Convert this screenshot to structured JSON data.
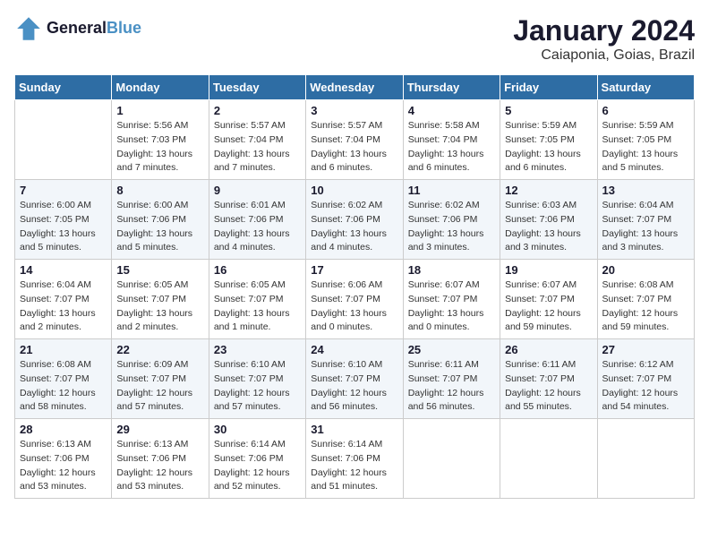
{
  "logo": {
    "line1": "General",
    "line2": "Blue"
  },
  "title": "January 2024",
  "location": "Caiaponia, Goias, Brazil",
  "days_header": [
    "Sunday",
    "Monday",
    "Tuesday",
    "Wednesday",
    "Thursday",
    "Friday",
    "Saturday"
  ],
  "weeks": [
    [
      {
        "day": "",
        "sunrise": "",
        "sunset": "",
        "daylight": ""
      },
      {
        "day": "1",
        "sunrise": "Sunrise: 5:56 AM",
        "sunset": "Sunset: 7:03 PM",
        "daylight": "Daylight: 13 hours and 7 minutes."
      },
      {
        "day": "2",
        "sunrise": "Sunrise: 5:57 AM",
        "sunset": "Sunset: 7:04 PM",
        "daylight": "Daylight: 13 hours and 7 minutes."
      },
      {
        "day": "3",
        "sunrise": "Sunrise: 5:57 AM",
        "sunset": "Sunset: 7:04 PM",
        "daylight": "Daylight: 13 hours and 6 minutes."
      },
      {
        "day": "4",
        "sunrise": "Sunrise: 5:58 AM",
        "sunset": "Sunset: 7:04 PM",
        "daylight": "Daylight: 13 hours and 6 minutes."
      },
      {
        "day": "5",
        "sunrise": "Sunrise: 5:59 AM",
        "sunset": "Sunset: 7:05 PM",
        "daylight": "Daylight: 13 hours and 6 minutes."
      },
      {
        "day": "6",
        "sunrise": "Sunrise: 5:59 AM",
        "sunset": "Sunset: 7:05 PM",
        "daylight": "Daylight: 13 hours and 5 minutes."
      }
    ],
    [
      {
        "day": "7",
        "sunrise": "Sunrise: 6:00 AM",
        "sunset": "Sunset: 7:05 PM",
        "daylight": "Daylight: 13 hours and 5 minutes."
      },
      {
        "day": "8",
        "sunrise": "Sunrise: 6:00 AM",
        "sunset": "Sunset: 7:06 PM",
        "daylight": "Daylight: 13 hours and 5 minutes."
      },
      {
        "day": "9",
        "sunrise": "Sunrise: 6:01 AM",
        "sunset": "Sunset: 7:06 PM",
        "daylight": "Daylight: 13 hours and 4 minutes."
      },
      {
        "day": "10",
        "sunrise": "Sunrise: 6:02 AM",
        "sunset": "Sunset: 7:06 PM",
        "daylight": "Daylight: 13 hours and 4 minutes."
      },
      {
        "day": "11",
        "sunrise": "Sunrise: 6:02 AM",
        "sunset": "Sunset: 7:06 PM",
        "daylight": "Daylight: 13 hours and 3 minutes."
      },
      {
        "day": "12",
        "sunrise": "Sunrise: 6:03 AM",
        "sunset": "Sunset: 7:06 PM",
        "daylight": "Daylight: 13 hours and 3 minutes."
      },
      {
        "day": "13",
        "sunrise": "Sunrise: 6:04 AM",
        "sunset": "Sunset: 7:07 PM",
        "daylight": "Daylight: 13 hours and 3 minutes."
      }
    ],
    [
      {
        "day": "14",
        "sunrise": "Sunrise: 6:04 AM",
        "sunset": "Sunset: 7:07 PM",
        "daylight": "Daylight: 13 hours and 2 minutes."
      },
      {
        "day": "15",
        "sunrise": "Sunrise: 6:05 AM",
        "sunset": "Sunset: 7:07 PM",
        "daylight": "Daylight: 13 hours and 2 minutes."
      },
      {
        "day": "16",
        "sunrise": "Sunrise: 6:05 AM",
        "sunset": "Sunset: 7:07 PM",
        "daylight": "Daylight: 13 hours and 1 minute."
      },
      {
        "day": "17",
        "sunrise": "Sunrise: 6:06 AM",
        "sunset": "Sunset: 7:07 PM",
        "daylight": "Daylight: 13 hours and 0 minutes."
      },
      {
        "day": "18",
        "sunrise": "Sunrise: 6:07 AM",
        "sunset": "Sunset: 7:07 PM",
        "daylight": "Daylight: 13 hours and 0 minutes."
      },
      {
        "day": "19",
        "sunrise": "Sunrise: 6:07 AM",
        "sunset": "Sunset: 7:07 PM",
        "daylight": "Daylight: 12 hours and 59 minutes."
      },
      {
        "day": "20",
        "sunrise": "Sunrise: 6:08 AM",
        "sunset": "Sunset: 7:07 PM",
        "daylight": "Daylight: 12 hours and 59 minutes."
      }
    ],
    [
      {
        "day": "21",
        "sunrise": "Sunrise: 6:08 AM",
        "sunset": "Sunset: 7:07 PM",
        "daylight": "Daylight: 12 hours and 58 minutes."
      },
      {
        "day": "22",
        "sunrise": "Sunrise: 6:09 AM",
        "sunset": "Sunset: 7:07 PM",
        "daylight": "Daylight: 12 hours and 57 minutes."
      },
      {
        "day": "23",
        "sunrise": "Sunrise: 6:10 AM",
        "sunset": "Sunset: 7:07 PM",
        "daylight": "Daylight: 12 hours and 57 minutes."
      },
      {
        "day": "24",
        "sunrise": "Sunrise: 6:10 AM",
        "sunset": "Sunset: 7:07 PM",
        "daylight": "Daylight: 12 hours and 56 minutes."
      },
      {
        "day": "25",
        "sunrise": "Sunrise: 6:11 AM",
        "sunset": "Sunset: 7:07 PM",
        "daylight": "Daylight: 12 hours and 56 minutes."
      },
      {
        "day": "26",
        "sunrise": "Sunrise: 6:11 AM",
        "sunset": "Sunset: 7:07 PM",
        "daylight": "Daylight: 12 hours and 55 minutes."
      },
      {
        "day": "27",
        "sunrise": "Sunrise: 6:12 AM",
        "sunset": "Sunset: 7:07 PM",
        "daylight": "Daylight: 12 hours and 54 minutes."
      }
    ],
    [
      {
        "day": "28",
        "sunrise": "Sunrise: 6:13 AM",
        "sunset": "Sunset: 7:06 PM",
        "daylight": "Daylight: 12 hours and 53 minutes."
      },
      {
        "day": "29",
        "sunrise": "Sunrise: 6:13 AM",
        "sunset": "Sunset: 7:06 PM",
        "daylight": "Daylight: 12 hours and 53 minutes."
      },
      {
        "day": "30",
        "sunrise": "Sunrise: 6:14 AM",
        "sunset": "Sunset: 7:06 PM",
        "daylight": "Daylight: 12 hours and 52 minutes."
      },
      {
        "day": "31",
        "sunrise": "Sunrise: 6:14 AM",
        "sunset": "Sunset: 7:06 PM",
        "daylight": "Daylight: 12 hours and 51 minutes."
      },
      {
        "day": "",
        "sunrise": "",
        "sunset": "",
        "daylight": ""
      },
      {
        "day": "",
        "sunrise": "",
        "sunset": "",
        "daylight": ""
      },
      {
        "day": "",
        "sunrise": "",
        "sunset": "",
        "daylight": ""
      }
    ]
  ]
}
